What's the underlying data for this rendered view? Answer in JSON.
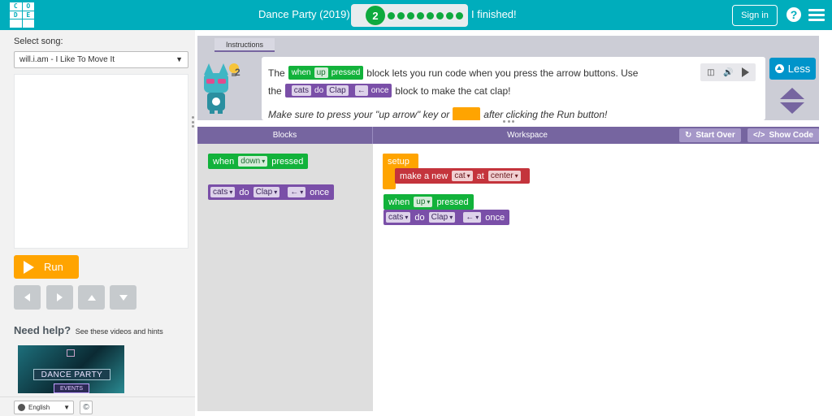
{
  "header": {
    "logo_letters": [
      "C",
      "O",
      "D",
      "E",
      "",
      ""
    ],
    "level_title": "Dance Party (2019)",
    "progress_current": "2",
    "finished_label": "I finished!",
    "signin_label": "Sign in",
    "help_label": "?"
  },
  "left": {
    "select_song_label": "Select song:",
    "song_value": "will.i.am - I Like To Move It",
    "run_label": "Run",
    "need_help_title": "Need help?",
    "need_help_sub": "See these videos and hints",
    "video": {
      "title": "DANCE PARTY",
      "subtitle": "EVENTS"
    },
    "language_value": "English",
    "copyright_label": "©"
  },
  "instructions": {
    "tab_label": "Instructions",
    "hint_count": "2",
    "line1": {
      "pre": "The",
      "block_when": "when",
      "block_key": "up",
      "block_pressed": "pressed",
      "post": "block lets you run code when you press the arrow buttons. Use"
    },
    "line2": {
      "pre": "the",
      "block_group": "cats",
      "block_do": "do",
      "block_move": "Clap",
      "block_dir": "←",
      "block_once": "once",
      "post": "block to make the cat clap!"
    },
    "line3": {
      "pre": "Make sure to press your \"up arrow\" key or",
      "post": "after clicking the Run button!"
    },
    "less_label": "Less"
  },
  "code": {
    "blocks_label": "Blocks",
    "workspace_label": "Workspace",
    "start_over_label": "Start Over",
    "show_code_label": "Show Code",
    "toolbox": {
      "when_block": {
        "when": "when",
        "key": "down",
        "pressed": "pressed"
      },
      "do_block": {
        "group": "cats",
        "do": "do",
        "move": "Clap",
        "dir": "←",
        "once": "once"
      }
    },
    "workspace": {
      "setup": "setup",
      "make_new": {
        "text": "make a new",
        "type": "cat",
        "at": "at",
        "pos": "center"
      },
      "when_block": {
        "when": "when",
        "key": "up",
        "pressed": "pressed"
      },
      "do_block": {
        "group": "cats",
        "do": "do",
        "move": "Clap",
        "dir": "←",
        "once": "once"
      }
    }
  },
  "colors": {
    "header": "#00adbc",
    "event_green": "#12b23b",
    "dance_purple": "#7a4fa8",
    "setup_orange": "#ffa400",
    "sprite_red": "#c4343c",
    "panel_purple": "#7665a0",
    "less_blue": "#0094ca"
  }
}
